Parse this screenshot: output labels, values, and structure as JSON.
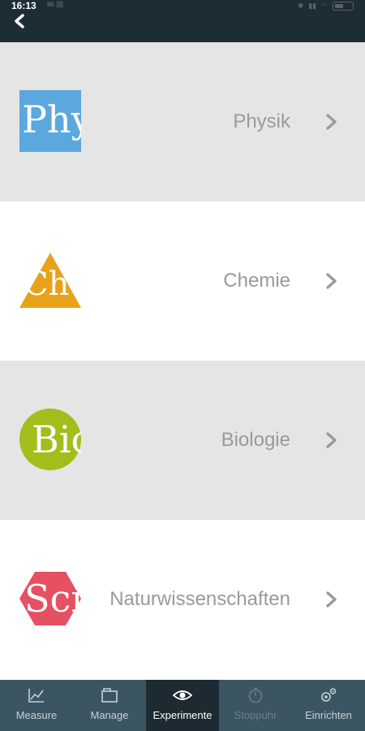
{
  "status_bar": {
    "time": "16:13",
    "notification_icons": "✉ ☒"
  },
  "app_bar": {
    "back_icon": "chevron-left-icon"
  },
  "subjects": [
    {
      "label": "Physik",
      "logo_text": "Phy",
      "logo_shape": "square",
      "logo_color": "#5aa8de",
      "row_color": "#e5e5e5"
    },
    {
      "label": "Chemie",
      "logo_text": "Che",
      "logo_shape": "triangle",
      "logo_color": "#e8a21a",
      "row_color": "#ffffff"
    },
    {
      "label": "Biologie",
      "logo_text": "Bio",
      "logo_shape": "circle",
      "logo_color": "#a3bd1b",
      "row_color": "#e5e5e5"
    },
    {
      "label": "Naturwissenschaften",
      "logo_text": "Sci",
      "logo_shape": "hexagon",
      "logo_color": "#e65062",
      "row_color": "#ffffff"
    }
  ],
  "bottom_nav": {
    "items": [
      {
        "label": "Measure",
        "icon": "chart-icon",
        "state": "normal"
      },
      {
        "label": "Manage",
        "icon": "folder-icon",
        "state": "normal"
      },
      {
        "label": "Experimente",
        "icon": "eye-icon",
        "state": "active"
      },
      {
        "label": "Stoppuhr",
        "icon": "stopwatch-icon",
        "state": "disabled"
      },
      {
        "label": "Einrichten",
        "icon": "settings-icon",
        "state": "normal"
      }
    ]
  },
  "colors": {
    "topbar": "#1e2c35",
    "bottom_nav": "#3b5662",
    "bottom_nav_active": "#1d2a31",
    "label_text": "#9a9a9a",
    "chevron": "#9a9a9a"
  }
}
